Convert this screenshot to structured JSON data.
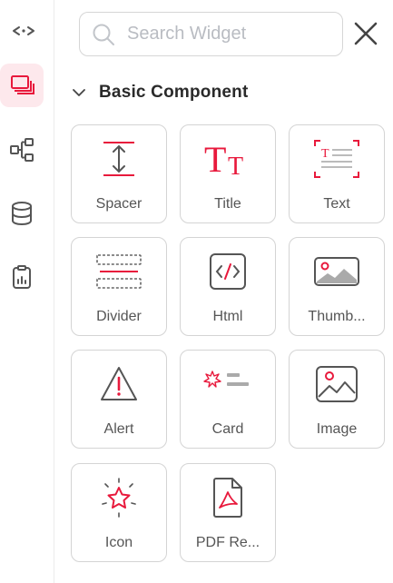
{
  "search": {
    "placeholder": "Search Widget",
    "value": ""
  },
  "section": {
    "title": "Basic Component"
  },
  "rail": {
    "items": [
      {
        "icon": "horizontal-resize-icon"
      },
      {
        "icon": "layers-icon",
        "active": true
      },
      {
        "icon": "hierarchy-icon"
      },
      {
        "icon": "database-icon"
      },
      {
        "icon": "clipboard-chart-icon"
      }
    ]
  },
  "widgets": [
    {
      "label": "Spacer",
      "icon": "spacer-icon"
    },
    {
      "label": "Title",
      "icon": "title-icon"
    },
    {
      "label": "Text",
      "icon": "text-icon"
    },
    {
      "label": "Divider",
      "icon": "divider-icon"
    },
    {
      "label": "Html",
      "icon": "html-icon"
    },
    {
      "label": "Thumb...",
      "icon": "thumbnail-icon"
    },
    {
      "label": "Alert",
      "icon": "alert-icon"
    },
    {
      "label": "Card",
      "icon": "card-icon"
    },
    {
      "label": "Image",
      "icon": "image-icon"
    },
    {
      "label": "Icon",
      "icon": "star-icon"
    },
    {
      "label": "PDF Re...",
      "icon": "pdf-icon"
    }
  ],
  "colors": {
    "accent": "#e8193c",
    "icon_gray": "#555555",
    "card_border": "#d4d4d4",
    "active_bg": "#fde8ec"
  }
}
